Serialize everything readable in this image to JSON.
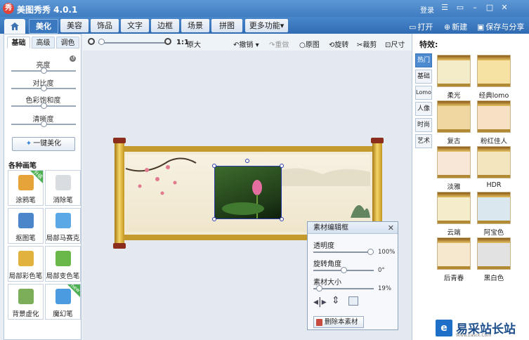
{
  "window": {
    "title": "美图秀秀 4.0.1",
    "login_label": "登录",
    "controls": [
      "menu-icon",
      "message-icon",
      "minimize-icon",
      "maximize-icon",
      "close-icon"
    ]
  },
  "main_tabs": [
    {
      "label": "美化",
      "active": true
    },
    {
      "label": "美容"
    },
    {
      "label": "饰品"
    },
    {
      "label": "文字"
    },
    {
      "label": "边框"
    },
    {
      "label": "场景"
    },
    {
      "label": "拼图"
    },
    {
      "label": "更多功能▾"
    }
  ],
  "top_actions": {
    "open": "打开",
    "new": "新建",
    "save": "保存与分享"
  },
  "left_panel": {
    "subtabs": [
      {
        "label": "基础",
        "active": true
      },
      {
        "label": "高级"
      },
      {
        "label": "调色"
      }
    ],
    "sliders": [
      {
        "label": "亮度",
        "value": 0.5
      },
      {
        "label": "对比度",
        "value": 0.5
      },
      {
        "label": "色彩饱和度",
        "value": 0.5
      },
      {
        "label": "清晰度",
        "value": 0.5
      }
    ],
    "one_key_label": "一键美化",
    "brush_header": "各种画笔",
    "tools": [
      {
        "label": "涂鸦笔",
        "icon": "doodle-brush-icon",
        "color": "#e6a33a",
        "badge": "升级"
      },
      {
        "label": "消除笔",
        "icon": "eraser-icon",
        "color": "#d9dde2"
      },
      {
        "label": "抠图笔",
        "icon": "cutout-brush-icon",
        "color": "#4a86c9"
      },
      {
        "label": "局部马赛克",
        "icon": "mosaic-icon",
        "color": "#5aa9e6"
      },
      {
        "label": "局部彩色笔",
        "icon": "color-brush-icon",
        "color": "#e1b23e"
      },
      {
        "label": "局部变色笔",
        "icon": "recolor-brush-icon",
        "color": "#6bb84a"
      },
      {
        "label": "背景虚化",
        "icon": "blur-background-icon",
        "color": "#7cae5a"
      },
      {
        "label": "魔幻笔",
        "icon": "magic-brush-icon",
        "color": "#4a9be0",
        "badge": "new"
      }
    ]
  },
  "toolbar": {
    "ratio_label": "1:1",
    "original_size": "原大",
    "undo": "撤销",
    "redo": "重做",
    "original": "原图",
    "rotate": "旋转",
    "crop": "裁剪",
    "size": "尺寸"
  },
  "material_dialog": {
    "title": "素材编辑框",
    "opacity_label": "透明度",
    "opacity_value": "100%",
    "opacity_fraction": 1.0,
    "rotation_label": "旋转角度",
    "rotation_value": "0°",
    "rotation_fraction": 0.5,
    "size_label": "素材大小",
    "size_value": "19%",
    "size_fraction": 0.05,
    "delete_label": "删除本素材"
  },
  "right_panel": {
    "title": "特效:",
    "categories": [
      {
        "label": "热门",
        "active": true
      },
      {
        "label": "基础"
      },
      {
        "label": "Lomo"
      },
      {
        "label": "人像"
      },
      {
        "label": "时尚"
      },
      {
        "label": "艺术"
      }
    ],
    "effects": [
      {
        "label": "柔光",
        "color": "#f4ecc9"
      },
      {
        "label": "经典lomo",
        "color": "#f6e3a4"
      },
      {
        "label": "复古",
        "color": "#f0d6a0"
      },
      {
        "label": "粉红佳人",
        "color": "#f6e1c4"
      },
      {
        "label": "淡雅",
        "color": "#f8e7d6"
      },
      {
        "label": "HDR",
        "color": "#f3e6bf"
      },
      {
        "label": "云端",
        "color": "#f4eccb"
      },
      {
        "label": "阿宝色",
        "color": "#dbe7ee"
      },
      {
        "label": "后青春",
        "color": "#f6e8cf"
      },
      {
        "label": "黑白色",
        "color": "#e2e2e2"
      }
    ]
  },
  "watermark": {
    "text": "易采站长站",
    "sub": "Www.Easck.Com"
  }
}
